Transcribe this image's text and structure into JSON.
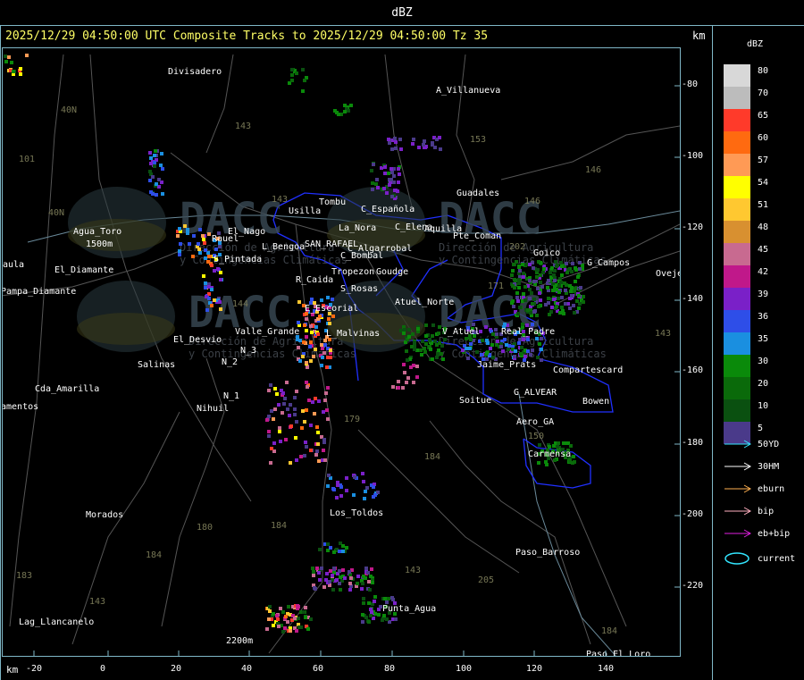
{
  "window": {
    "title": "dBZ"
  },
  "header": {
    "text": "2025/12/29 04:50:00 UTC Composite Tracks to 2025/12/29 04:50:00 Tz 35",
    "km_label": "km"
  },
  "legend": {
    "title": "dBZ",
    "scale": [
      {
        "value": "80",
        "color": "#d8d8d8"
      },
      {
        "value": "70",
        "color": "#bcbcbc"
      },
      {
        "value": "65",
        "color": "#ff3a2a"
      },
      {
        "value": "60",
        "color": "#ff6a10"
      },
      {
        "value": "57",
        "color": "#ff9a55"
      },
      {
        "value": "54",
        "color": "#ffff00"
      },
      {
        "value": "51",
        "color": "#ffc830"
      },
      {
        "value": "48",
        "color": "#d89030"
      },
      {
        "value": "45",
        "color": "#c86a90"
      },
      {
        "value": "42",
        "color": "#c0188a"
      },
      {
        "value": "39",
        "color": "#7a20c8"
      },
      {
        "value": "36",
        "color": "#2e4ee8"
      },
      {
        "value": "35",
        "color": "#1a8fe0"
      },
      {
        "value": "30",
        "color": "#0a8a0a"
      },
      {
        "value": "20",
        "color": "#0a6a0a"
      },
      {
        "value": "10",
        "color": "#0a5010"
      },
      {
        "value": "5",
        "color": "#4a3a8a"
      }
    ],
    "tracks": [
      {
        "label": "50YD",
        "color": "#33e6ff"
      },
      {
        "label": "30HM",
        "color": "#ffffff"
      },
      {
        "label": "eburn",
        "color": "#ffb050"
      },
      {
        "label": "bip",
        "color": "#ffb0c0"
      },
      {
        "label": "eb+bip",
        "color": "#e020e0"
      }
    ],
    "current_label": "current",
    "current_color": "#33e6ff"
  },
  "axes": {
    "x_unit": "km",
    "x_ticks": [
      "-20",
      "0",
      "20",
      "40",
      "60",
      "80",
      "100",
      "120",
      "140"
    ],
    "y_ticks": [
      "-80",
      "-100",
      "-120",
      "-140",
      "-160",
      "-180",
      "-200",
      "-220"
    ]
  },
  "map": {
    "places": [
      {
        "name": "Divisadero",
        "color": "#ffffff"
      },
      {
        "name": "A_Villanueva",
        "color": "#ffffff"
      },
      {
        "name": "Guadales",
        "color": "#ffffff"
      },
      {
        "name": "Tombu",
        "color": "#ffffff"
      },
      {
        "name": "C_Española",
        "color": "#ffffff"
      },
      {
        "name": "Usilla",
        "color": "#ffffff"
      },
      {
        "name": "La_Nora",
        "color": "#ffffff"
      },
      {
        "name": "C_Elena",
        "color": "#ffffff"
      },
      {
        "name": "Aquilla",
        "color": "#ffffff"
      },
      {
        "name": "Pte_Coman",
        "color": "#ffffff"
      },
      {
        "name": "Agua_Toro",
        "color": "#ffffff"
      },
      {
        "name": "1500m",
        "color": "#ffffff"
      },
      {
        "name": "El_Nago",
        "color": "#ffffff"
      },
      {
        "name": "Rauel",
        "color": "#ffffff"
      },
      {
        "name": "L_Bengoa",
        "color": "#ffffff"
      },
      {
        "name": "SAN_RAFAEL",
        "color": "#ffffff"
      },
      {
        "name": "C_Algarrobal",
        "color": "#ffffff"
      },
      {
        "name": "C_Bombal",
        "color": "#ffffff"
      },
      {
        "name": "Goico",
        "color": "#ffffff"
      },
      {
        "name": "G_Campos",
        "color": "#ffffff"
      },
      {
        "name": "Ovejer",
        "color": "#ffffff"
      },
      {
        "name": "aula",
        "color": "#ffffff"
      },
      {
        "name": "El_Diamante",
        "color": "#ffffff"
      },
      {
        "name": "Pampa_Diamante",
        "color": "#ffffff"
      },
      {
        "name": "S_Pintada",
        "color": "#ffffff"
      },
      {
        "name": "Tropezon",
        "color": "#ffffff"
      },
      {
        "name": "Goudge",
        "color": "#ffffff"
      },
      {
        "name": "R_Caida",
        "color": "#ffffff"
      },
      {
        "name": "S_Rosas",
        "color": "#ffffff"
      },
      {
        "name": "Atuel_Norte",
        "color": "#ffffff"
      },
      {
        "name": "E_Escorial",
        "color": "#ffffff"
      },
      {
        "name": "Valle_Grande",
        "color": "#ffffff"
      },
      {
        "name": "L_Malvinas",
        "color": "#ffffff"
      },
      {
        "name": "V_Atuel",
        "color": "#ffffff"
      },
      {
        "name": "Real_Padre",
        "color": "#ffffff"
      },
      {
        "name": "El_Desvio",
        "color": "#ffffff"
      },
      {
        "name": "Salinas",
        "color": "#ffffff"
      },
      {
        "name": "N_2",
        "color": "#ffffff"
      },
      {
        "name": "N_3",
        "color": "#ffffff"
      },
      {
        "name": "Jaime_Prats",
        "color": "#ffffff"
      },
      {
        "name": "Compartescard",
        "color": "#ffffff"
      },
      {
        "name": "Cda_Amarilla",
        "color": "#ffffff"
      },
      {
        "name": "N_1",
        "color": "#ffffff"
      },
      {
        "name": "Nihuil",
        "color": "#ffffff"
      },
      {
        "name": "Soitue",
        "color": "#ffffff"
      },
      {
        "name": "G_ALVEAR",
        "color": "#ffffff"
      },
      {
        "name": "Bowen",
        "color": "#ffffff"
      },
      {
        "name": "amentos",
        "color": "#ffffff"
      },
      {
        "name": "Aero_GA",
        "color": "#ffffff"
      },
      {
        "name": "Carmensa",
        "color": "#ffffff"
      },
      {
        "name": "Morados",
        "color": "#ffffff"
      },
      {
        "name": "Los_Toldos",
        "color": "#ffffff"
      },
      {
        "name": "Paso_Barroso",
        "color": "#ffffff"
      },
      {
        "name": "Punta_Agua",
        "color": "#ffffff"
      },
      {
        "name": "Lag_Llancanelo",
        "color": "#ffffff"
      },
      {
        "name": "2200m",
        "color": "#ffffff"
      },
      {
        "name": "Paso_El_Loro",
        "color": "#ffffff"
      }
    ],
    "route_labels": [
      "143",
      "153",
      "146",
      "143",
      "101",
      "40N",
      "40N",
      "144",
      "146",
      "171",
      "202",
      "179",
      "180",
      "184",
      "184",
      "184",
      "183",
      "143",
      "150",
      "205",
      "143",
      "143",
      "184"
    ],
    "watermark": {
      "brand": "DACC",
      "line1": "Dirección de Agricultura",
      "line2": "y Contingencias Climáticas"
    }
  }
}
